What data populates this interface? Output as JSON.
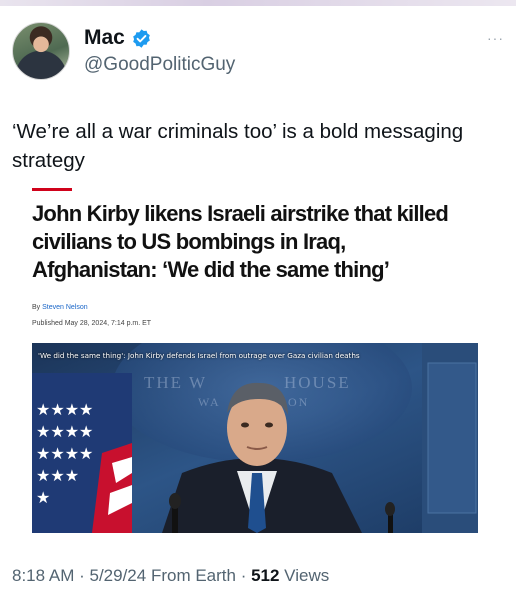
{
  "author": {
    "display_name": "Mac",
    "handle": "@GoodPoliticGuy",
    "verified_icon": "verified-badge-icon",
    "verified_color": "#1d9bf0"
  },
  "more_label": "···",
  "tweet": {
    "text": "‘We’re all a war criminals too’ is a bold messaging strategy"
  },
  "article": {
    "accent_color": "#d0021b",
    "headline": "John Kirby likens Israeli airstrike that killed civilians to US bombings in Iraq, Afghanistan: ‘We did the same thing’",
    "byline_prefix": "By",
    "author": "Steven Nelson",
    "published": "Published May 28, 2024, 7:14 p.m. ET",
    "video": {
      "caption": "'We did the same thing': John Kirby defends Israel from outrage over Gaza civilian deaths",
      "backdrop_text_left": "THE W",
      "backdrop_text_right": "HOUSE",
      "backdrop_text_left2": "WA",
      "backdrop_text_right2": "ON"
    }
  },
  "footer": {
    "time": "8:18 AM",
    "sep1": " · ",
    "date": "5/29/24",
    "source": " From Earth",
    "sep2": " · ",
    "views_count": "512",
    "views_label": " Views"
  }
}
